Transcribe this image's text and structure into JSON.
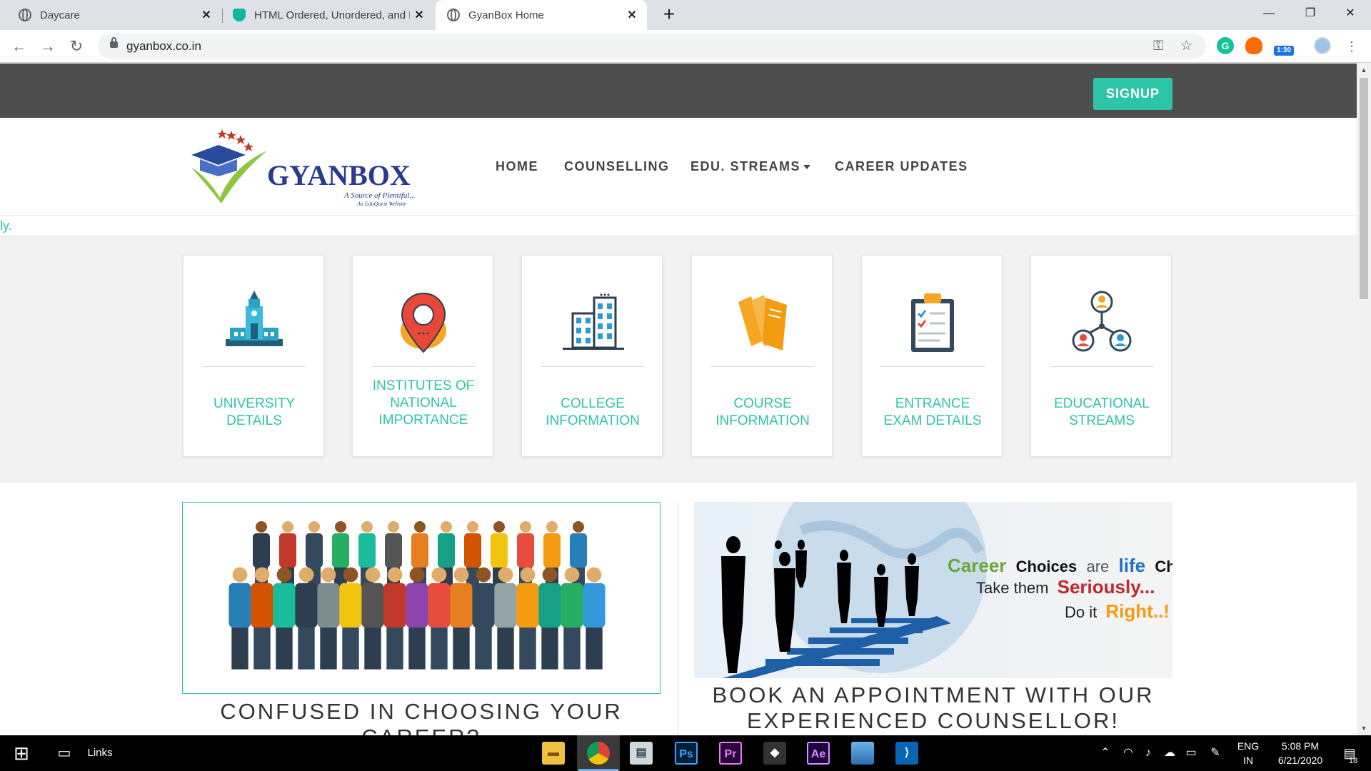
{
  "browser": {
    "tabs": [
      {
        "title": "Daycare",
        "icon": "globe-icon"
      },
      {
        "title": "HTML Ordered, Unordered, and D",
        "icon": "shield-icon"
      },
      {
        "title": "GyanBox Home",
        "icon": "globe-icon",
        "active": true
      }
    ],
    "url": "gyanbox.co.in",
    "extension_badge": "1:30"
  },
  "site": {
    "signup_label": "SIGNUP",
    "logo": {
      "brand": "GYANBOX",
      "tagline": "A Source of Plentiful...",
      "subtagline": "An EduQuest Website"
    },
    "nav": [
      {
        "label": "HOME"
      },
      {
        "label": "COUNSELLING"
      },
      {
        "label": "EDU. STREAMS",
        "dropdown": true
      },
      {
        "label": "CAREER UPDATES"
      }
    ],
    "ticker_text": "ly.",
    "cards": [
      {
        "line1": "UNIVERSITY",
        "line2": "DETAILS",
        "icon": "university-icon"
      },
      {
        "line1": "INSTITUTES OF",
        "line2": "NATIONAL",
        "line3": "IMPORTANCE",
        "icon": "location-pin-icon"
      },
      {
        "line1": "COLLEGE",
        "line2": "INFORMATION",
        "icon": "building-icon"
      },
      {
        "line1": "COURSE",
        "line2": "INFORMATION",
        "icon": "books-icon"
      },
      {
        "line1": "ENTRANCE",
        "line2": "EXAM DETAILS",
        "icon": "clipboard-icon"
      },
      {
        "line1": "EDUCATIONAL",
        "line2": "STREAMS",
        "icon": "network-icon"
      }
    ],
    "sections": {
      "career_heading_line1": "CONFUSED IN CHOOSING YOUR",
      "career_heading_line2": "CAREER?",
      "appointment_heading_line1": "BOOK AN APPOINTMENT WITH OUR",
      "appointment_heading_line2": "EXPERIENCED COUNSELLOR!",
      "banner": {
        "w1": "Career",
        "w2": "Choices",
        "w3": "are",
        "w4": "life",
        "w5": "Choices",
        "w6": "Take them",
        "w7": "Seriously...",
        "w8": "Do it",
        "w9": "Right..!"
      }
    }
  },
  "taskbar": {
    "links_label": "Links",
    "apps": [
      "file-explorer-icon",
      "chrome-icon",
      "photos-icon",
      "Ps",
      "Pr",
      "unity-icon",
      "Ae",
      "photos-app-icon",
      "vscode-icon"
    ],
    "language_line1": "ENG",
    "language_line2": "IN",
    "time": "5:08 PM",
    "date": "6/21/2020",
    "notification_count": "18"
  },
  "colors": {
    "accent": "#2ec4a7",
    "topbar": "#4e4e4e",
    "nav_text": "#444444"
  }
}
